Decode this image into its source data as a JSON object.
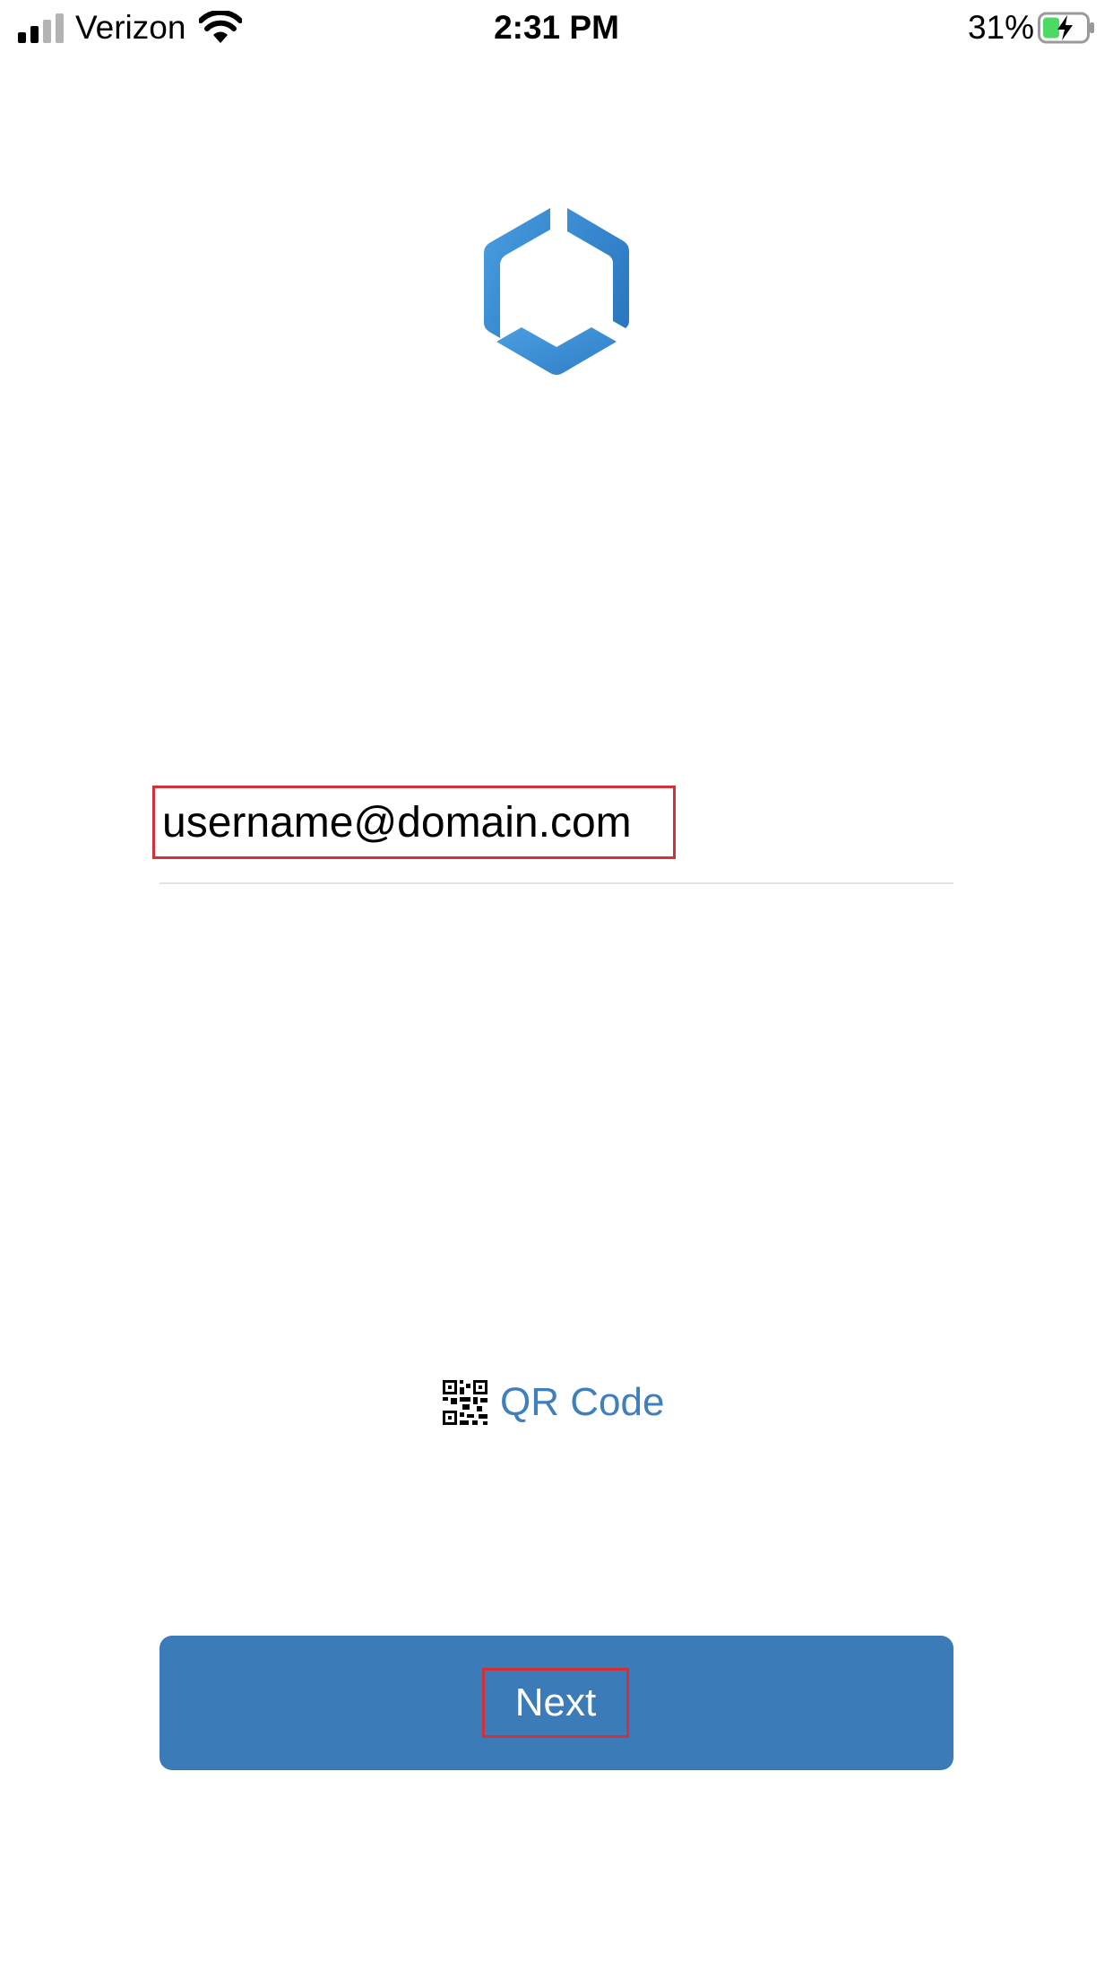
{
  "status_bar": {
    "carrier": "Verizon",
    "time": "2:31 PM",
    "battery_percent": "31%",
    "battery_charging": true,
    "signal_bars_active": 2,
    "signal_bars_total": 4,
    "icons": [
      "signal-icon",
      "wifi-icon",
      "battery-charging-icon"
    ]
  },
  "logo": {
    "icon": "hexagon-logo-icon",
    "color": "#3d8fd6"
  },
  "login": {
    "email_value": "username@domain.com",
    "qr_link_label": "QR Code",
    "qr_icon": "qr-code-icon",
    "next_label": "Next"
  },
  "colors": {
    "accent": "#3b7bb7",
    "link": "#3e7fbc",
    "highlight": "#d3303a"
  }
}
